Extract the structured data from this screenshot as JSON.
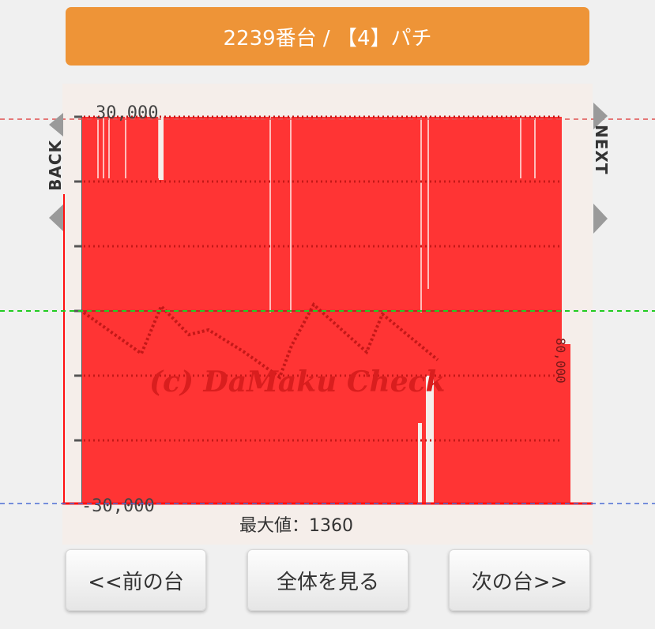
{
  "header": {
    "title": "2239番台 / 【4】パチ"
  },
  "nav": {
    "back_label": "BACK",
    "next_label": "NEXT"
  },
  "graph": {
    "y_top_label": "30,000",
    "y_bottom_label": "-30,000",
    "right_label": "80,000",
    "watermark": "(c) DaMaku Check",
    "max_label": "最大値：1360"
  },
  "buttons": {
    "prev": "<<前の台",
    "all": "全体を見る",
    "next": "次の台>>"
  },
  "chart_data": {
    "type": "area",
    "title": "",
    "xlabel": "",
    "ylabel": "",
    "ylim": [
      -30000,
      30000
    ],
    "y_ticks": [
      "30,000",
      "-30,000"
    ],
    "grid": true,
    "series_color": "#ff3434",
    "reference_lines": [
      {
        "value": 30000,
        "color": "#e05050",
        "style": "dashed"
      },
      {
        "value": 0,
        "color": "#22cc22",
        "style": "dashed"
      },
      {
        "value": -30000,
        "color": "#4a6cd4",
        "style": "dashed"
      }
    ],
    "max_value": 1360
  },
  "colors": {
    "accent": "#ee9437",
    "graph_fill": "#ff3434",
    "graph_bg": "#f5eeea"
  }
}
